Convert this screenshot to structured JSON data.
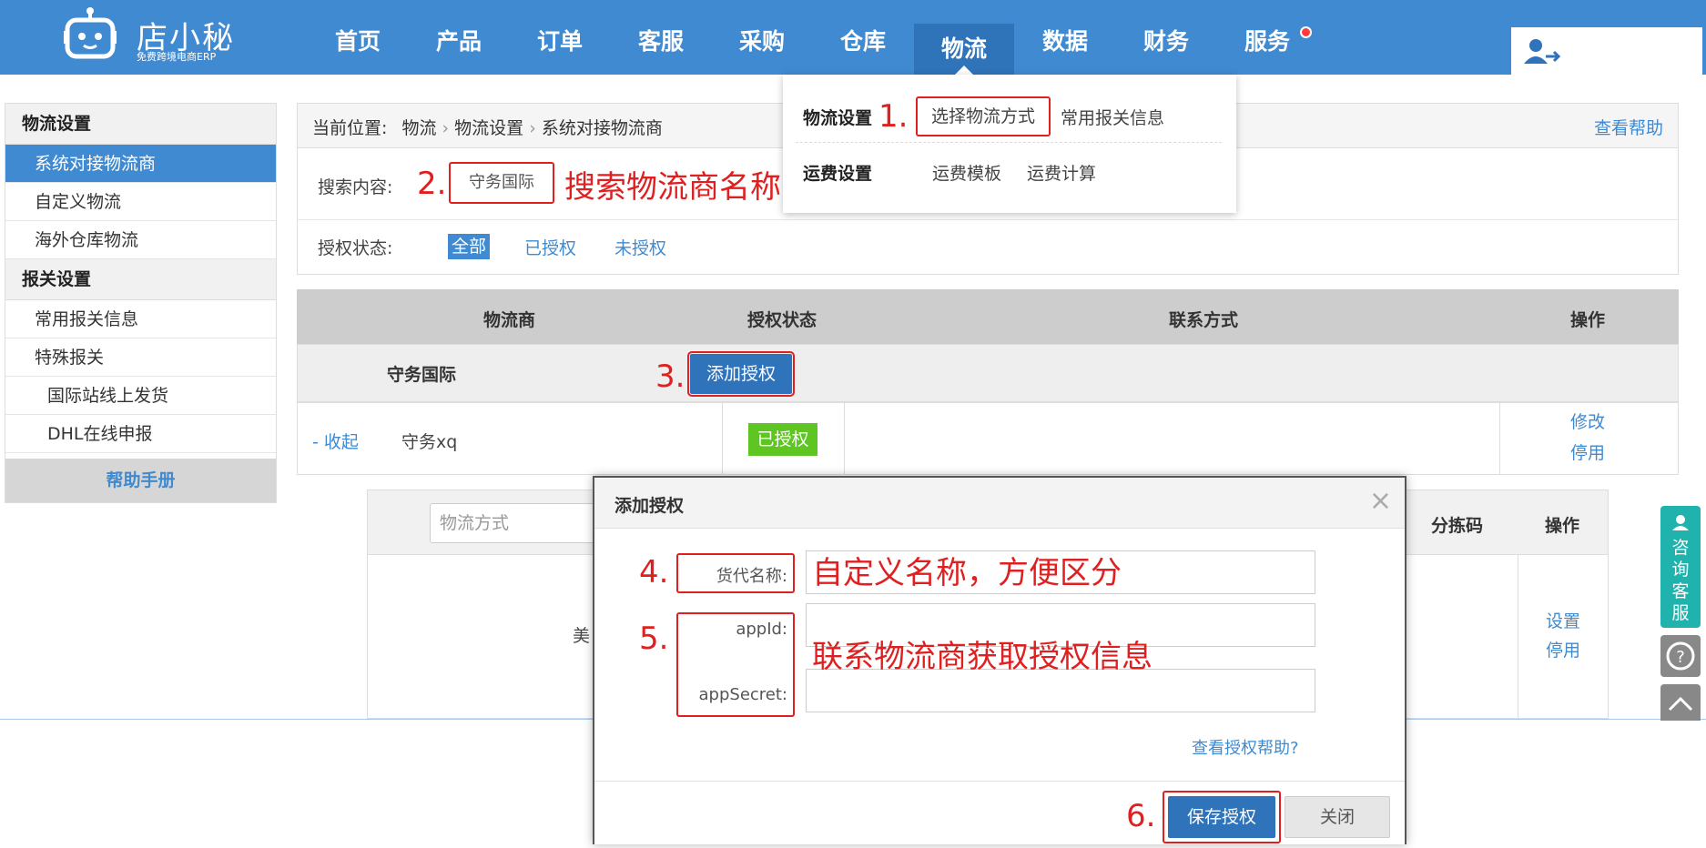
{
  "header": {
    "logo_text": "店小秘",
    "logo_sub": "免费跨境电商ERP",
    "nav": [
      "首页",
      "产品",
      "订单",
      "客服",
      "采购",
      "仓库",
      "物流",
      "数据",
      "财务",
      "服务"
    ],
    "active_nav": "物流"
  },
  "sidebar": {
    "sections": [
      {
        "title": "物流设置",
        "items": [
          "系统对接物流商",
          "自定义物流",
          "海外仓库物流"
        ]
      },
      {
        "title": "报关设置",
        "items": [
          "常用报关信息",
          "特殊报关",
          "国际站线上发货",
          "DHL在线申报"
        ]
      }
    ],
    "active_item": "系统对接物流商",
    "help": "帮助手册"
  },
  "breadcrumb": {
    "label": "当前位置:",
    "items": [
      "物流",
      "物流设置",
      "系统对接物流商"
    ],
    "help_link": "查看帮助"
  },
  "filters": {
    "search_label": "搜索内容:",
    "search_value": "守务国际",
    "auth_label": "授权状态:",
    "auth_options": [
      "全部",
      "已授权",
      "未授权"
    ]
  },
  "table": {
    "columns": [
      "物流商",
      "授权状态",
      "联系方式",
      "操作"
    ],
    "group_name": "守务国际",
    "add_button": "添加授权",
    "row": {
      "toggle": "- 收起",
      "name": "守务xq",
      "status": "已授权",
      "actions": [
        "修改",
        "停用"
      ]
    }
  },
  "subtable": {
    "search_placeholder": "物流方式",
    "col_sort": "分拣码",
    "col_ops": "操作",
    "partial_text": "美",
    "actions": [
      "设置",
      "停用"
    ]
  },
  "dropdown": {
    "row1_title": "物流设置",
    "row1_items": [
      "选择物流方式",
      "常用报关信息"
    ],
    "row2_title": "运费设置",
    "row2_items": [
      "运费模板",
      "运费计算"
    ]
  },
  "modal": {
    "title": "添加授权",
    "close": "×",
    "field_name_label": "货代名称:",
    "field_appid_label": "appId:",
    "field_secret_label": "appSecret:",
    "help_link": "查看授权帮助?",
    "save": "保存授权",
    "cancel": "关闭"
  },
  "annotations": {
    "n1": "1.",
    "n2": "2.",
    "n3": "3.",
    "n4": "4.",
    "n5": "5.",
    "n6": "6.",
    "search_hint": "搜索物流商名称",
    "name_hint": "自定义名称，方便区分",
    "auth_hint": "联系物流商获取授权信息"
  },
  "float_bar": {
    "service": "咨询客服"
  },
  "colors": {
    "primary": "#3f8ad0",
    "annotation": "#e02020",
    "authorized": "#5ec522",
    "service": "#20b3ad"
  }
}
